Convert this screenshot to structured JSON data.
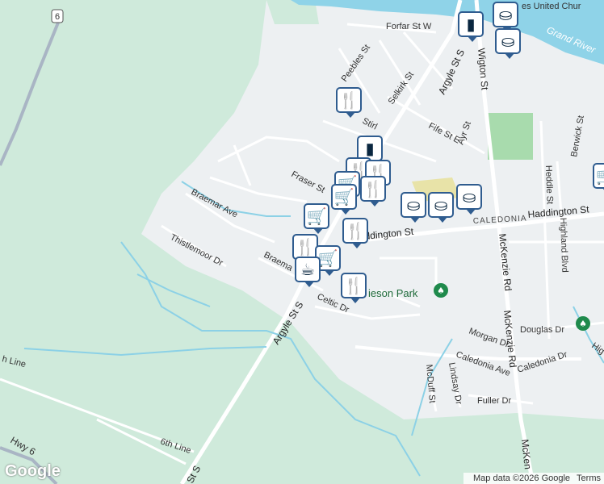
{
  "map": {
    "colors": {
      "green": "#cfeadb",
      "urban": "#edf0f2",
      "water": "#8fd3e8",
      "stream": "#8cd1e6",
      "park": "#a8dbad",
      "road": "#ffffff",
      "highway": "#a9b5c4",
      "pin_border": "#2f5c8f"
    },
    "streets": {
      "forfar": "Forfar St W",
      "peebles": "Peebles St",
      "selkirk": "Selkirk St",
      "argyle_n": "Argyle St S",
      "wigton": "Wigton St",
      "fife": "Fife St E",
      "ayr": "Ayr St",
      "stirling": "Stirl",
      "fraser": "Fraser St",
      "braemar_ave": "Braemar Ave",
      "braemar": "Braema",
      "thistlemoor": "Thistlemoor Dr",
      "haddington_w": "ddington St",
      "haddington_e": "Haddington St",
      "caledonia_lbl": "CALEDONIA",
      "mckenzie1": "McKenzie Rd",
      "mckenzie2": "McKenzie Rd",
      "mckenzie3": "McKen",
      "heddle": "Heddle St",
      "highland": "Highland Blvd",
      "berwick": "Berwick St",
      "douglas": "Douglas Dr",
      "morgan": "Morgan Dr",
      "caledonia_ave": "Caledonia Ave",
      "caledonia_dr": "Caledonia Dr",
      "lindsay": "Lindsay Dr",
      "mcduff": "McDuff St",
      "fuller": "Fuller Dr",
      "celtic": "Celtic Dr",
      "argyle_s": "Argyle St S",
      "argyle_s2": "St S",
      "sixth_line": "6th Line",
      "sixth_line_w": "h Line",
      "hwy6": "Hwy 6",
      "high": "Hig"
    },
    "shield": "6",
    "river": "Grand River",
    "river_top": "es United Chur",
    "park": "ieson Park",
    "google": "Google",
    "attribution": {
      "data": "Map data ©2026 Google",
      "terms": "Terms"
    }
  },
  "pins": [
    {
      "icon": "⛀",
      "name": "school-icon"
    },
    {
      "icon": "⛀",
      "name": "school-icon"
    },
    {
      "icon": "▮",
      "name": "shopping-bag-icon"
    },
    {
      "icon": "🍴",
      "name": "restaurant-icon"
    },
    {
      "icon": "▮",
      "name": "shopping-bag-icon"
    },
    {
      "icon": "🍴",
      "name": "restaurant-icon"
    },
    {
      "icon": "🍴",
      "name": "restaurant-icon"
    },
    {
      "icon": "🛒",
      "name": "grocery-cart-icon"
    },
    {
      "icon": "🍴",
      "name": "restaurant-icon"
    },
    {
      "icon": "⛀",
      "name": "school-icon"
    },
    {
      "icon": "⛀",
      "name": "school-icon"
    },
    {
      "icon": "⛀",
      "name": "school-icon"
    },
    {
      "icon": "🛒",
      "name": "grocery-cart-icon"
    },
    {
      "icon": "🛒",
      "name": "grocery-cart-icon"
    },
    {
      "icon": "🍴",
      "name": "restaurant-icon"
    },
    {
      "icon": "🍴",
      "name": "restaurant-icon"
    },
    {
      "icon": "🛒",
      "name": "grocery-cart-icon"
    },
    {
      "icon": "☕",
      "name": "coffee-cup-icon"
    },
    {
      "icon": "🍴",
      "name": "restaurant-icon"
    },
    {
      "icon": "🛒",
      "name": "grocery-cart-icon"
    }
  ]
}
